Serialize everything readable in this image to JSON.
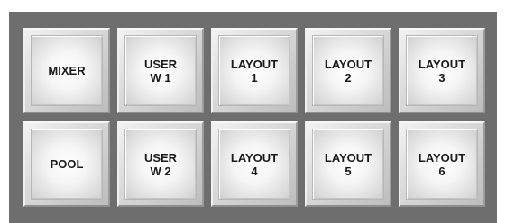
{
  "keys": [
    {
      "label": "MIXER"
    },
    {
      "label": "USER\nW 1"
    },
    {
      "label": "LAYOUT\n1"
    },
    {
      "label": "LAYOUT\n2"
    },
    {
      "label": "LAYOUT\n3"
    },
    {
      "label": "POOL"
    },
    {
      "label": "USER\nW 2"
    },
    {
      "label": "LAYOUT\n4"
    },
    {
      "label": "LAYOUT\n5"
    },
    {
      "label": "LAYOUT\n6"
    }
  ],
  "colors": {
    "panel": "#6e6e6e",
    "key_face": "#f2f2f2",
    "label_text": "#1a1a1a"
  }
}
